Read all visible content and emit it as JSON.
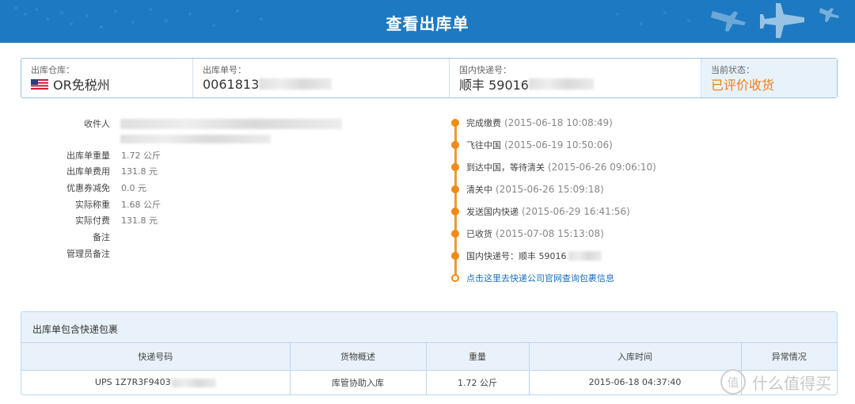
{
  "header": {
    "title": "查看出库单"
  },
  "info": {
    "warehouse_label": "出库仓库：",
    "warehouse_value": "OR免税州",
    "order_no_label": "出库单号：",
    "order_no_value": "0061813",
    "domestic_label": "国内快递号：",
    "domestic_value": "顺丰 59016",
    "status_label": "当前状态：",
    "status_value": "已评价收货"
  },
  "details": [
    {
      "key": "收件人",
      "value": ""
    },
    {
      "key": "出库单重量",
      "value": "1.72 公斤"
    },
    {
      "key": "出库单费用",
      "value": "131.8 元"
    },
    {
      "key": "优惠券减免",
      "value": "0.0 元"
    },
    {
      "key": "实际称重",
      "value": "1.68 公斤"
    },
    {
      "key": "实际付费",
      "value": "131.8 元"
    },
    {
      "key": "备注",
      "value": ""
    },
    {
      "key": "管理员备注",
      "value": ""
    }
  ],
  "timeline": [
    {
      "text": "完成缴费",
      "time": "(2015-06-18 10:08:49)"
    },
    {
      "text": "飞往中国",
      "time": "(2015-06-19 10:50:06)"
    },
    {
      "text": "到达中国，等待清关",
      "time": "(2015-06-26 09:06:10)"
    },
    {
      "text": "清关中",
      "time": "(2015-06-26 15:09:18)"
    },
    {
      "text": "发送国内快递",
      "time": "(2015-06-29 16:41:56)"
    },
    {
      "text": "已收货",
      "time": "(2015-07-08 15:13:08)"
    },
    {
      "text": "国内快递号：顺丰 59016",
      "time": ""
    }
  ],
  "timeline_link": "点击这里去快递公司官网查询包裹信息",
  "packages": {
    "title": "出库单包含快递包裹",
    "columns": [
      "快递号码",
      "货物概述",
      "重量",
      "入库时间",
      "异常情况"
    ],
    "rows": [
      {
        "tracking": "UPS 1Z7R3F9403",
        "desc": "库管协助入库",
        "weight": "1.72 公斤",
        "time": "2015-06-18 04:37:40",
        "exception": ""
      }
    ]
  },
  "watermark": {
    "text": "什么值得买",
    "icon_glyph": "值"
  },
  "colors": {
    "header": "#1d7ac2",
    "accent": "#f08a16",
    "link": "#1a6fbf"
  }
}
